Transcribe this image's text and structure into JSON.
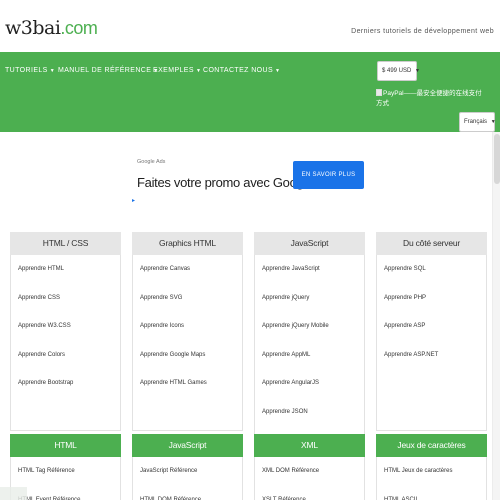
{
  "header": {
    "logo_prefix": "w3bai",
    "logo_suffix": ".com",
    "tagline": "Derniers tutoriels de développement web"
  },
  "nav": {
    "items": [
      {
        "label": "TUTORIELS"
      },
      {
        "label": "MANUEL DE RÉFÉRENCE"
      },
      {
        "label": "EXEMPLES"
      },
      {
        "label": "CONTACTEZ NOUS"
      }
    ],
    "caret": "▼",
    "currency_select": "$ 499 USD",
    "language_select": "Français",
    "paypal_alt": "PayPal——最安全便捷的在线支付方式"
  },
  "ad": {
    "label": "Google Ads",
    "text": "Faites votre promo avec Google",
    "button": "EN SAVOIR PLUS",
    "marker": "▸"
  },
  "columns_row1": [
    {
      "title": "HTML / CSS",
      "links": [
        "Apprendre HTML",
        "Apprendre CSS",
        "Apprendre W3.CSS",
        "Apprendre Colors",
        "Apprendre Bootstrap"
      ]
    },
    {
      "title": "Graphics HTML",
      "links": [
        "Apprendre Canvas",
        "Apprendre SVG",
        "Apprendre Icons",
        "Apprendre Google Maps",
        "Apprendre HTML Games"
      ]
    },
    {
      "title": "JavaScript",
      "links": [
        "Apprendre JavaScript",
        "Apprendre jQuery",
        "Apprendre jQuery Mobile",
        "Apprendre AppML",
        "Apprendre AngularJS",
        "Apprendre JSON"
      ]
    },
    {
      "title": "Du côté serveur",
      "links": [
        "Apprendre SQL",
        "Apprendre PHP",
        "Apprendre ASP",
        "Apprendre ASP.NET"
      ]
    }
  ],
  "columns_row2": [
    {
      "title": "HTML",
      "links": [
        "HTML Tag Référence",
        "HTML Event Référence"
      ]
    },
    {
      "title": "JavaScript",
      "links": [
        "JavaScript Référence",
        "HTML DOM Référence"
      ]
    },
    {
      "title": "XML",
      "links": [
        "XML DOM Référence",
        "XSLT Référence"
      ]
    },
    {
      "title": "Jeux de caractères",
      "links": [
        "HTML Jeux de caractères",
        "HTML ASCII"
      ]
    }
  ],
  "colors": {
    "brand_green": "#4caf50",
    "ad_blue": "#1a73e8",
    "header_gray": "#e6e6e6"
  }
}
